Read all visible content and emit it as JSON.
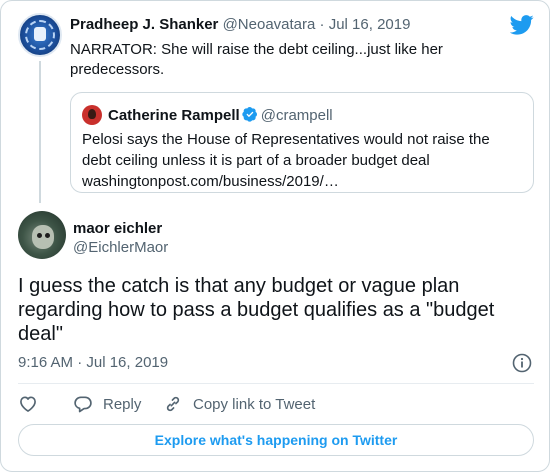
{
  "parent_tweet": {
    "author_name": "Pradheep J. Shanker",
    "handle": "@Neoavatara",
    "separator": " · ",
    "date": "Jul 16, 2019",
    "text": "NARRATOR: She will raise the debt ceiling...just like her predecessors."
  },
  "quoted_tweet": {
    "author_name": "Catherine Rampell",
    "handle": "@crampell",
    "text": "Pelosi says the House of Representatives would not raise the debt ceiling unless it is part of a broader budget deal washingtonpost.com/business/2019/…"
  },
  "main_tweet": {
    "author_name": "maor eichler",
    "handle": "@EichlerMaor",
    "text": "I guess the catch is that any budget or vague plan regarding how to pass a budget qualifies as a \"budget deal\"",
    "time": "9:16 AM · Jul 16, 2019"
  },
  "actions": {
    "reply_label": "Reply",
    "copy_link_label": "Copy link to Tweet"
  },
  "explore_label": "Explore what's happening on Twitter",
  "colors": {
    "accent": "#1d9bf0",
    "text_primary": "#0f1419",
    "text_secondary": "#536471",
    "border": "#cfd9de"
  },
  "icons": [
    "twitter-bird-icon",
    "verified-badge-icon",
    "info-icon",
    "heart-icon",
    "reply-icon",
    "link-icon"
  ]
}
